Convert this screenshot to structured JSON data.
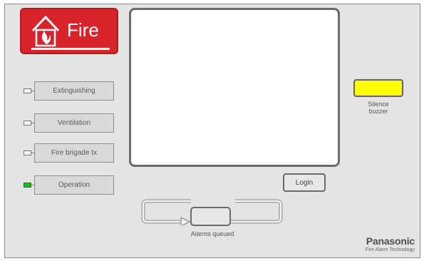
{
  "header": {
    "badge_text": "Fire",
    "badge_color": "#d8232a"
  },
  "indicators": [
    {
      "label": "Extinguishing",
      "led": "off"
    },
    {
      "label": "Ventilation",
      "led": "off"
    },
    {
      "label": "Fire brigade tx",
      "led": "off"
    },
    {
      "label": "Operation",
      "led": "on",
      "led_color": "#28b428"
    }
  ],
  "controls": {
    "login_label": "Login",
    "silence_label": "Silence\nbuzzer",
    "silence_color": "#ffff00",
    "queue_label": "Alarms queued"
  },
  "brand": {
    "name": "Panasonic",
    "tagline": "Fire Alarm Technology"
  }
}
